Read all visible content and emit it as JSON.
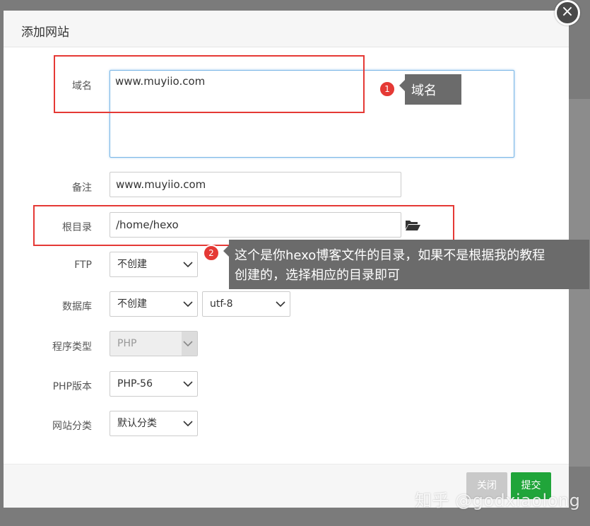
{
  "dialog": {
    "title": "添加网站",
    "close_symbol": "×"
  },
  "form": {
    "domain": {
      "label": "域名",
      "value": "www.muyiio.com"
    },
    "remark": {
      "label": "备注",
      "value": "www.muyiio.com"
    },
    "root_dir": {
      "label": "根目录",
      "value": "/home/hexo",
      "icon": "folder-open-icon"
    },
    "ftp": {
      "label": "FTP",
      "selected": "不创建"
    },
    "database": {
      "label": "数据库",
      "selected": "不创建",
      "charset": "utf-8"
    },
    "program_type": {
      "label": "程序类型",
      "selected": "PHP"
    },
    "php_version": {
      "label": "PHP版本",
      "selected": "PHP-56"
    },
    "site_category": {
      "label": "网站分类",
      "selected": "默认分类"
    }
  },
  "annotations": [
    {
      "number": "1",
      "text": "域名"
    },
    {
      "number": "2",
      "line1": "这个是你hexo博客文件的目录，如果不是根据我的教程",
      "line2": "创建的，选择相应的目录即可"
    }
  ],
  "footer": {
    "close_label": "关闭",
    "submit_label": "提交",
    "submit_color": "#20a53a"
  },
  "watermark": "知乎 @godxiaolong",
  "colors": {
    "annotation_red": "#e53935",
    "tooltip_bg": "#6b6b6b"
  }
}
